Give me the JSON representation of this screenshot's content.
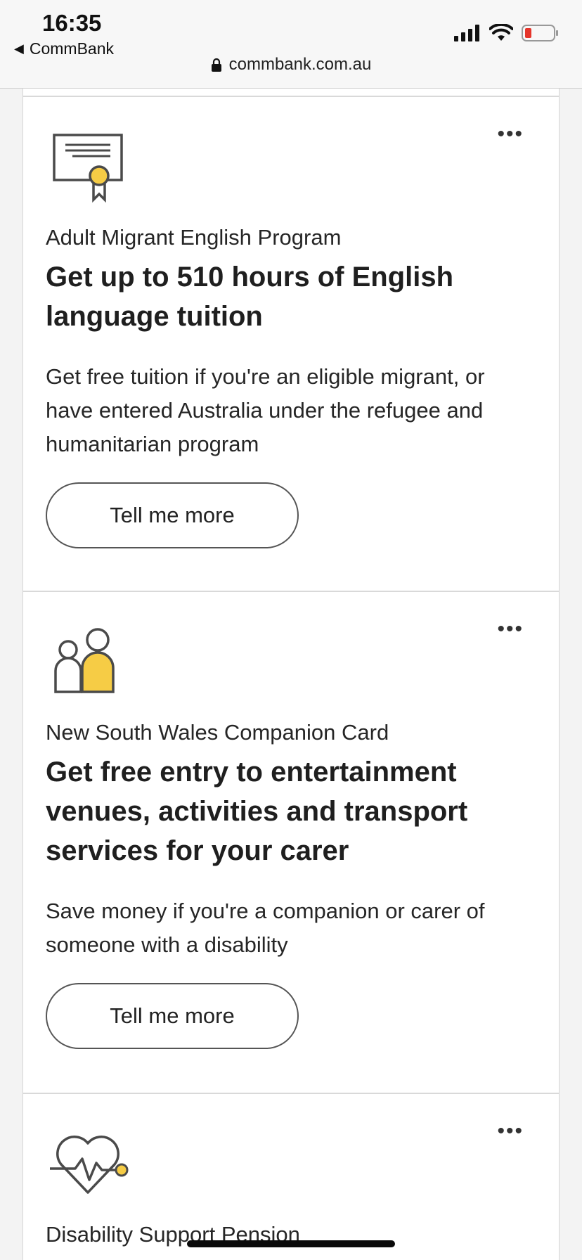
{
  "status_bar": {
    "time": "16:35",
    "back_app": "CommBank",
    "url": "commbank.com.au"
  },
  "cards": [
    {
      "icon": "certificate-icon",
      "eyebrow": "Adult Migrant English Program",
      "headline": "Get up to 510 hours of English language tuition",
      "description": "Get free tuition if you're an eligible migrant, or have entered Australia under the refugee and humanitarian program",
      "button_label": "Tell me more",
      "more_label": "•••"
    },
    {
      "icon": "companion-people-icon",
      "eyebrow": "New South Wales Companion Card",
      "headline": "Get free entry to entertainment venues, activities and transport services for your carer",
      "description": "Save money if you're a companion or carer of someone with a disability",
      "button_label": "Tell me more",
      "more_label": "•••"
    },
    {
      "icon": "heart-pulse-icon",
      "eyebrow": "Disability Support Pension",
      "more_label": "•••"
    }
  ],
  "colors": {
    "accent_yellow": "#f6cc45",
    "icon_stroke": "#4a4a4a"
  }
}
